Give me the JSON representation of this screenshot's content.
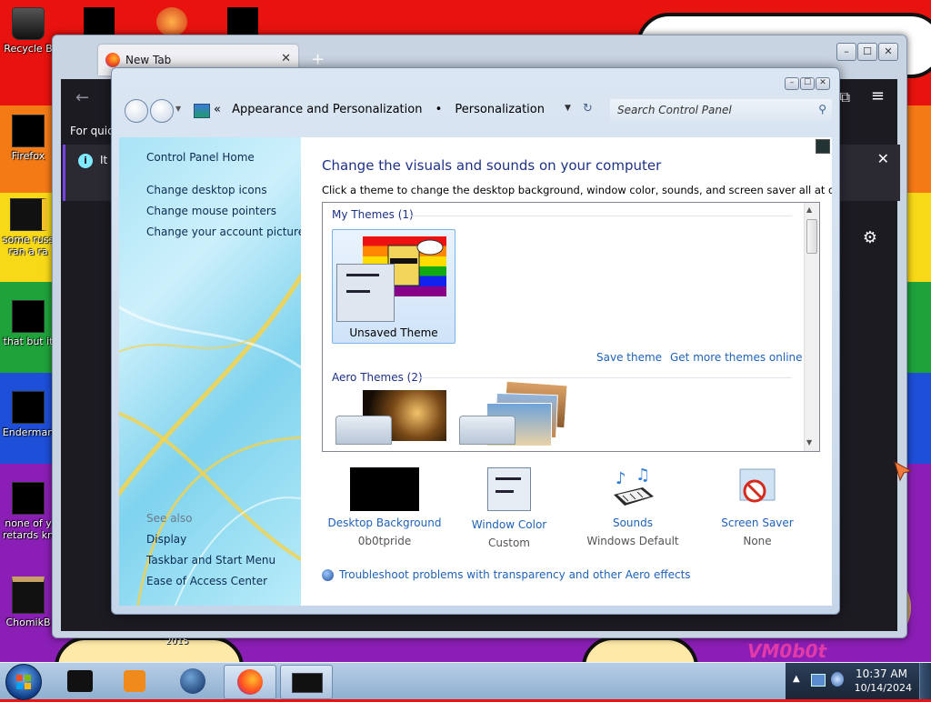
{
  "desktop": {
    "icons": [
      {
        "label": "Recycle Bin",
        "shown": "Recycle B"
      },
      {
        "label": "Firefox",
        "shown": "Firefox"
      },
      {
        "label": "some russ...\nran a ra...",
        "shown": "some russ"
      },
      {
        "label": "that but it...",
        "shown": "that but it"
      },
      {
        "label": "Enderman",
        "shown": "Enderman"
      },
      {
        "label": "none of y...\nretards kn...",
        "shown": "none of y"
      },
      {
        "label": "ChomikB...",
        "shown": "ChomikB"
      }
    ],
    "icon_second_lines": [
      "ran a ra",
      "retards kn"
    ],
    "wallpaper_text": "VM0b0t",
    "year_text": "2015"
  },
  "firefox": {
    "tab_title": "New Tab",
    "new_tab_glyph": "+",
    "quick_text": "For quick",
    "notice_text": "It I",
    "controls": {
      "min": "–",
      "max": "☐",
      "close": "✕"
    }
  },
  "control_panel": {
    "breadcrumb": {
      "prefix": "«",
      "parent": "Appearance and Personalization",
      "sep": "•",
      "current": "Personalization"
    },
    "search_placeholder": "Search Control Panel",
    "left_links": [
      "Control Panel Home",
      "Change desktop icons",
      "Change mouse pointers",
      "Change your account picture"
    ],
    "see_also_heading": "See also",
    "see_also_links": [
      "Display",
      "Taskbar and Start Menu",
      "Ease of Access Center"
    ],
    "title": "Change the visuals and sounds on your computer",
    "description": "Click a theme to change the desktop background, window color, sounds, and screen saver all at once.",
    "groups": {
      "my_themes": "My Themes (1)",
      "aero_themes": "Aero Themes (2)"
    },
    "unsaved_theme_name": "Unsaved Theme",
    "save_theme_link": "Save theme",
    "get_more_link": "Get more themes online",
    "options": [
      {
        "title": "Desktop Background",
        "value": "0b0tpride"
      },
      {
        "title": "Window Color",
        "value": "Custom"
      },
      {
        "title": "Sounds",
        "value": "Windows Default"
      },
      {
        "title": "Screen Saver",
        "value": "None"
      }
    ],
    "troubleshoot_link": "Troubleshoot problems with transparency and other Aero effects"
  },
  "taskbar": {
    "time": "10:37 AM",
    "date": "10/14/2024"
  },
  "colors": {
    "link": "#1e62b8",
    "heading": "#1e3287",
    "accent_purple": "#7542e5"
  }
}
